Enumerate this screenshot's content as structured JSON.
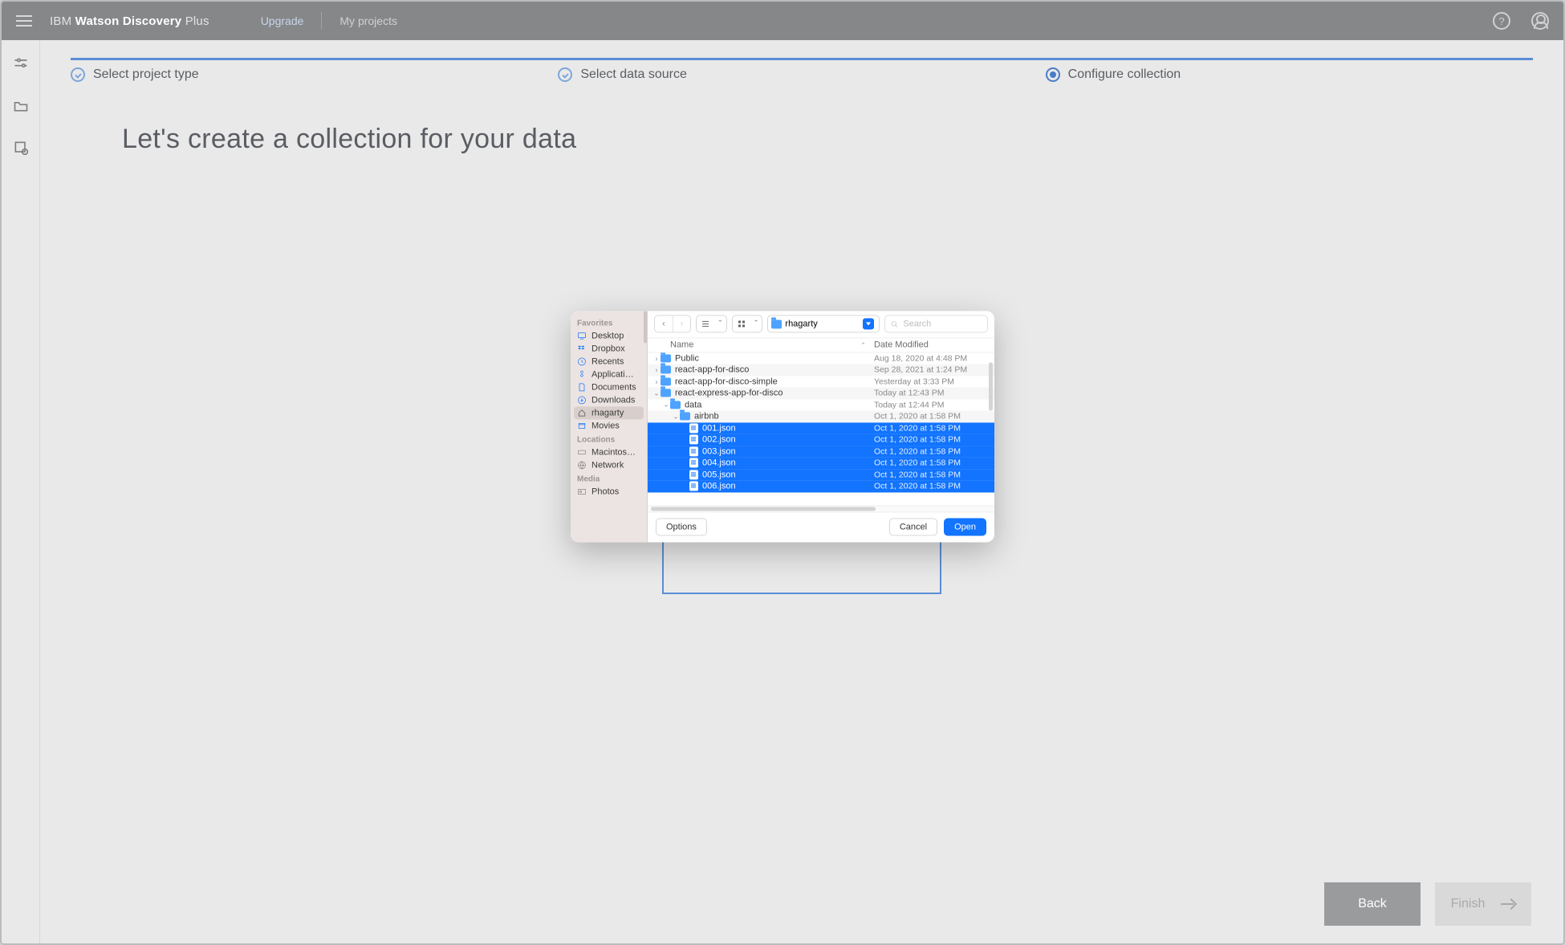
{
  "header": {
    "brand_prefix": "IBM ",
    "brand_bold": "Watson Discovery",
    "brand_suffix": " Plus",
    "upgrade": "Upgrade",
    "my_projects": "My projects"
  },
  "stepper": {
    "step1": "Select project type",
    "step2": "Select data source",
    "step3": "Configure collection"
  },
  "page": {
    "title": "Let's create a collection for your data"
  },
  "finder": {
    "sidebar": {
      "group_favorites": "Favorites",
      "desktop": "Desktop",
      "dropbox": "Dropbox",
      "recents": "Recents",
      "applications": "Applicati…",
      "documents": "Documents",
      "downloads": "Downloads",
      "rhagarty": "rhagarty",
      "movies": "Movies",
      "group_locations": "Locations",
      "macintosh": "Macintos…",
      "network": "Network",
      "group_media": "Media",
      "photos": "Photos"
    },
    "path": "rhagarty",
    "search_placeholder": "Search",
    "columns": {
      "name": "Name",
      "date": "Date Modified"
    },
    "rows": [
      {
        "kind": "folder",
        "indent": 0,
        "disclose": ">",
        "name": "Public",
        "date": "Aug 18, 2020 at 4:48 PM",
        "sel": false,
        "alt": false
      },
      {
        "kind": "folder",
        "indent": 0,
        "disclose": ">",
        "name": "react-app-for-disco",
        "date": "Sep 28, 2021 at 1:24 PM",
        "sel": false,
        "alt": true
      },
      {
        "kind": "folder",
        "indent": 0,
        "disclose": ">",
        "name": "react-app-for-disco-simple",
        "date": "Yesterday at 3:33 PM",
        "sel": false,
        "alt": false
      },
      {
        "kind": "folder",
        "indent": 0,
        "disclose": "v",
        "name": "react-express-app-for-disco",
        "date": "Today at 12:43 PM",
        "sel": false,
        "alt": true
      },
      {
        "kind": "folder",
        "indent": 1,
        "disclose": "v",
        "name": "data",
        "date": "Today at 12:44 PM",
        "sel": false,
        "alt": false
      },
      {
        "kind": "folder",
        "indent": 2,
        "disclose": "v",
        "name": "airbnb",
        "date": "Oct 1, 2020 at 1:58 PM",
        "sel": false,
        "alt": true
      },
      {
        "kind": "file",
        "indent": 3,
        "disclose": "",
        "name": "001.json",
        "date": "Oct 1, 2020 at 1:58 PM",
        "sel": true,
        "alt": false
      },
      {
        "kind": "file",
        "indent": 3,
        "disclose": "",
        "name": "002.json",
        "date": "Oct 1, 2020 at 1:58 PM",
        "sel": true,
        "alt": false
      },
      {
        "kind": "file",
        "indent": 3,
        "disclose": "",
        "name": "003.json",
        "date": "Oct 1, 2020 at 1:58 PM",
        "sel": true,
        "alt": false
      },
      {
        "kind": "file",
        "indent": 3,
        "disclose": "",
        "name": "004.json",
        "date": "Oct 1, 2020 at 1:58 PM",
        "sel": true,
        "alt": false
      },
      {
        "kind": "file",
        "indent": 3,
        "disclose": "",
        "name": "005.json",
        "date": "Oct 1, 2020 at 1:58 PM",
        "sel": true,
        "alt": false
      },
      {
        "kind": "file",
        "indent": 3,
        "disclose": "",
        "name": "006.json",
        "date": "Oct 1, 2020 at 1:58 PM",
        "sel": true,
        "alt": false
      }
    ],
    "buttons": {
      "options": "Options",
      "cancel": "Cancel",
      "open": "Open"
    }
  },
  "footer": {
    "back": "Back",
    "finish": "Finish"
  }
}
